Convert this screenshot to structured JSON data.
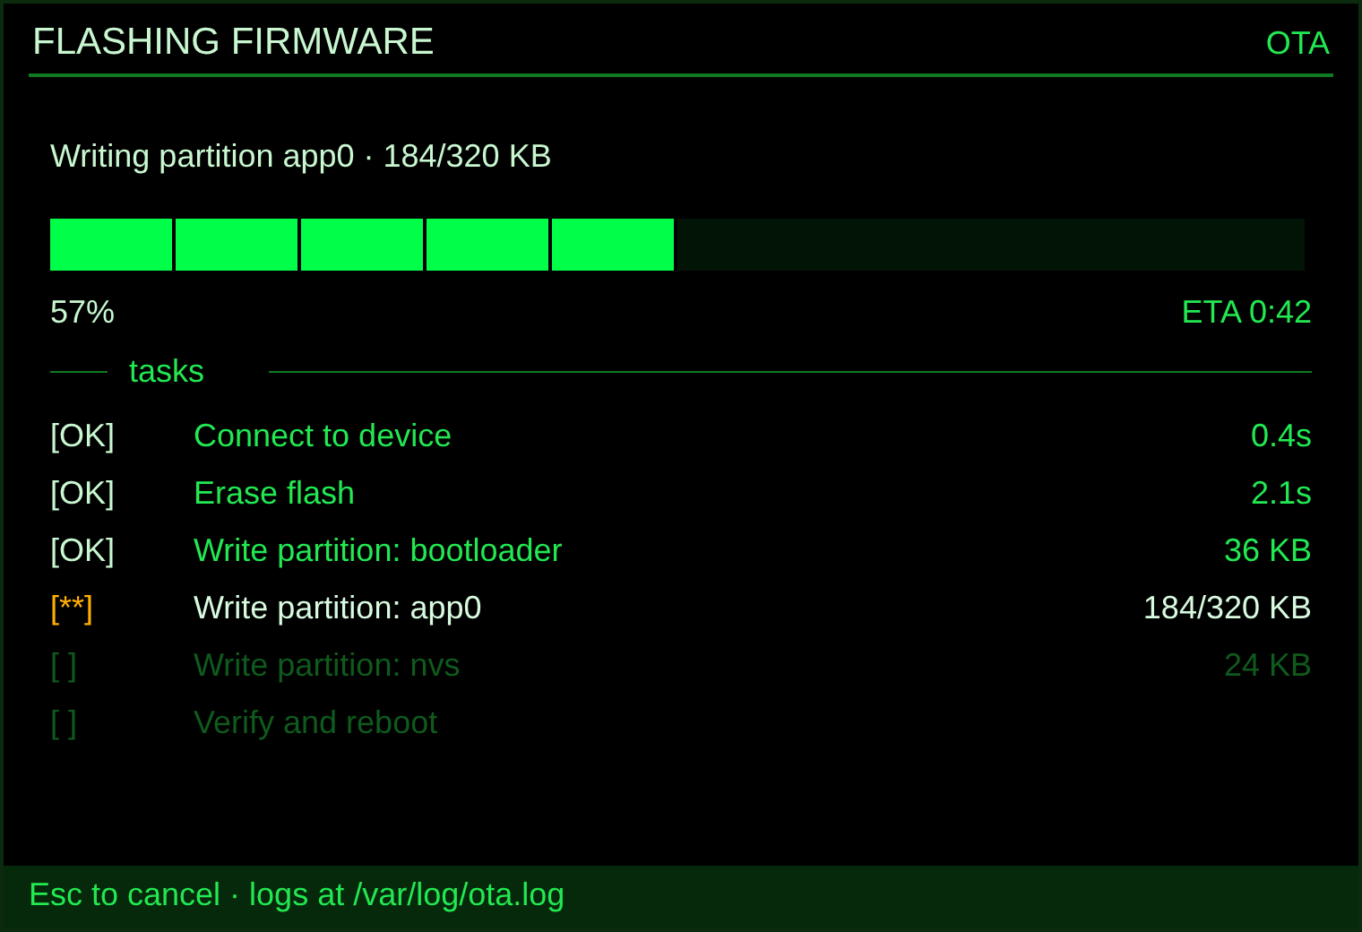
{
  "window": {
    "title": "FLASHING FIRMWARE",
    "badge": "OTA"
  },
  "progress": {
    "caption": "Writing partition app0 · 184/320 KB",
    "level": 0.5,
    "percent": "57%",
    "eta": "ETA 0:42"
  },
  "tasks_heading": "tasks",
  "tasks": [
    {
      "kind": "done",
      "status": "[OK]",
      "name": "Connect to device",
      "detail": "0.4s"
    },
    {
      "kind": "done",
      "status": "[OK]",
      "name": "Erase flash",
      "detail": "2.1s"
    },
    {
      "kind": "done",
      "status": "[OK]",
      "name": "Write partition: bootloader",
      "detail": "36 KB"
    },
    {
      "kind": "active",
      "status": "[**]",
      "name": "Write partition: app0",
      "detail": "184/320 KB"
    },
    {
      "kind": "pending",
      "status": "[ ]",
      "name": "Write partition: nvs",
      "detail": "24 KB"
    },
    {
      "kind": "pending",
      "status": "[ ]",
      "name": "Verify and reboot"
    }
  ],
  "status_bar": "Esc to cancel · logs at /var/log/ota.log"
}
